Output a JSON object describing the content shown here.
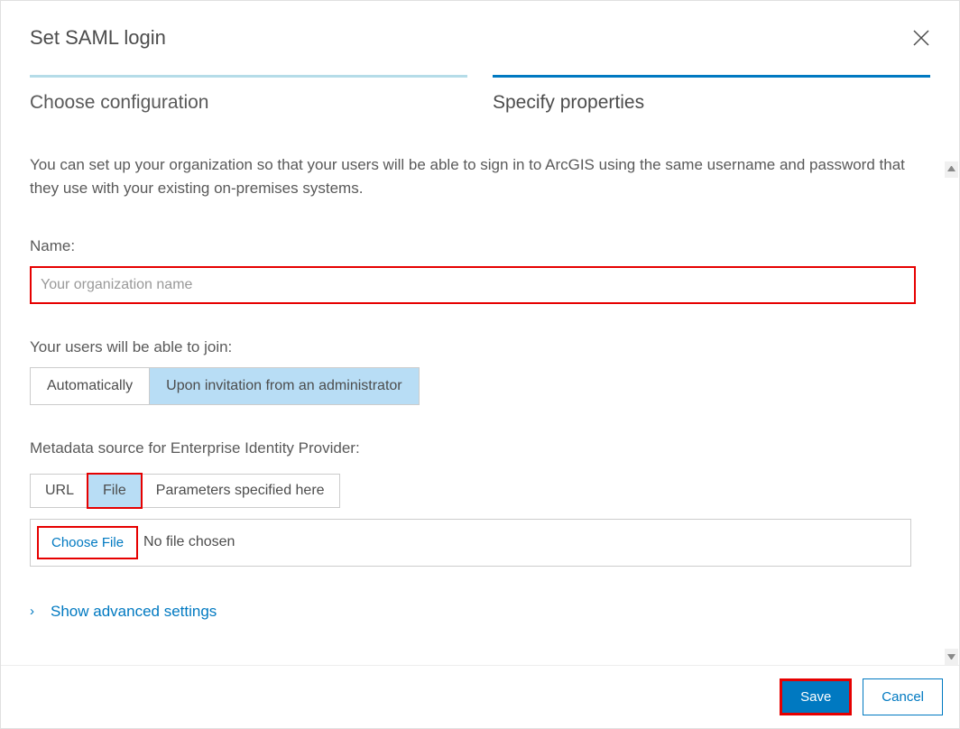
{
  "dialog": {
    "title": "Set SAML login"
  },
  "steps": {
    "choose": "Choose configuration",
    "specify": "Specify properties"
  },
  "description": "You can set up your organization so that your users will be able to sign in to ArcGIS using the same username and password that they use with your existing on-premises systems.",
  "name": {
    "label": "Name:",
    "placeholder": "Your organization name",
    "value": ""
  },
  "join": {
    "label": "Your users will be able to join:",
    "options": {
      "auto": "Automatically",
      "invite": "Upon invitation from an administrator"
    }
  },
  "metadata": {
    "label": "Metadata source for Enterprise Identity Provider:",
    "options": {
      "url": "URL",
      "file": "File",
      "params": "Parameters specified here"
    },
    "choose_file": "Choose File",
    "no_file": "No file chosen"
  },
  "advanced": {
    "label": "Show advanced settings"
  },
  "footer": {
    "save": "Save",
    "cancel": "Cancel"
  }
}
